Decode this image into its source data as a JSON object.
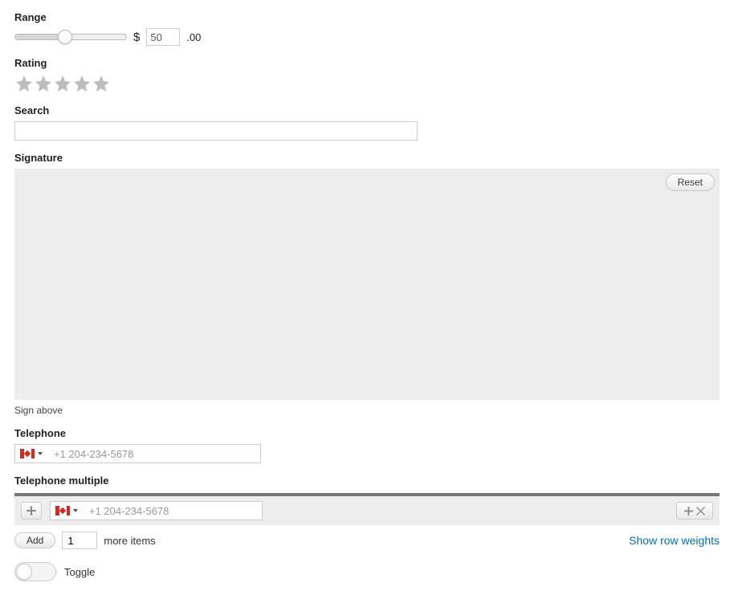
{
  "range": {
    "label": "Range",
    "currency_prefix": "$",
    "value": "50",
    "currency_suffix": ".00"
  },
  "rating": {
    "label": "Rating"
  },
  "search": {
    "label": "Search",
    "value": ""
  },
  "signature": {
    "label": "Signature",
    "reset_label": "Reset",
    "hint": "Sign above"
  },
  "telephone": {
    "label": "Telephone",
    "placeholder": "+1 204-234-5678",
    "value": ""
  },
  "telephone_multiple": {
    "label": "Telephone multiple",
    "row_placeholder": "+1 204-234-5678",
    "row_value": "",
    "add_label": "Add",
    "count": "1",
    "more_items": "more items",
    "show_weights": "Show row weights"
  },
  "toggle": {
    "label": "Toggle"
  }
}
